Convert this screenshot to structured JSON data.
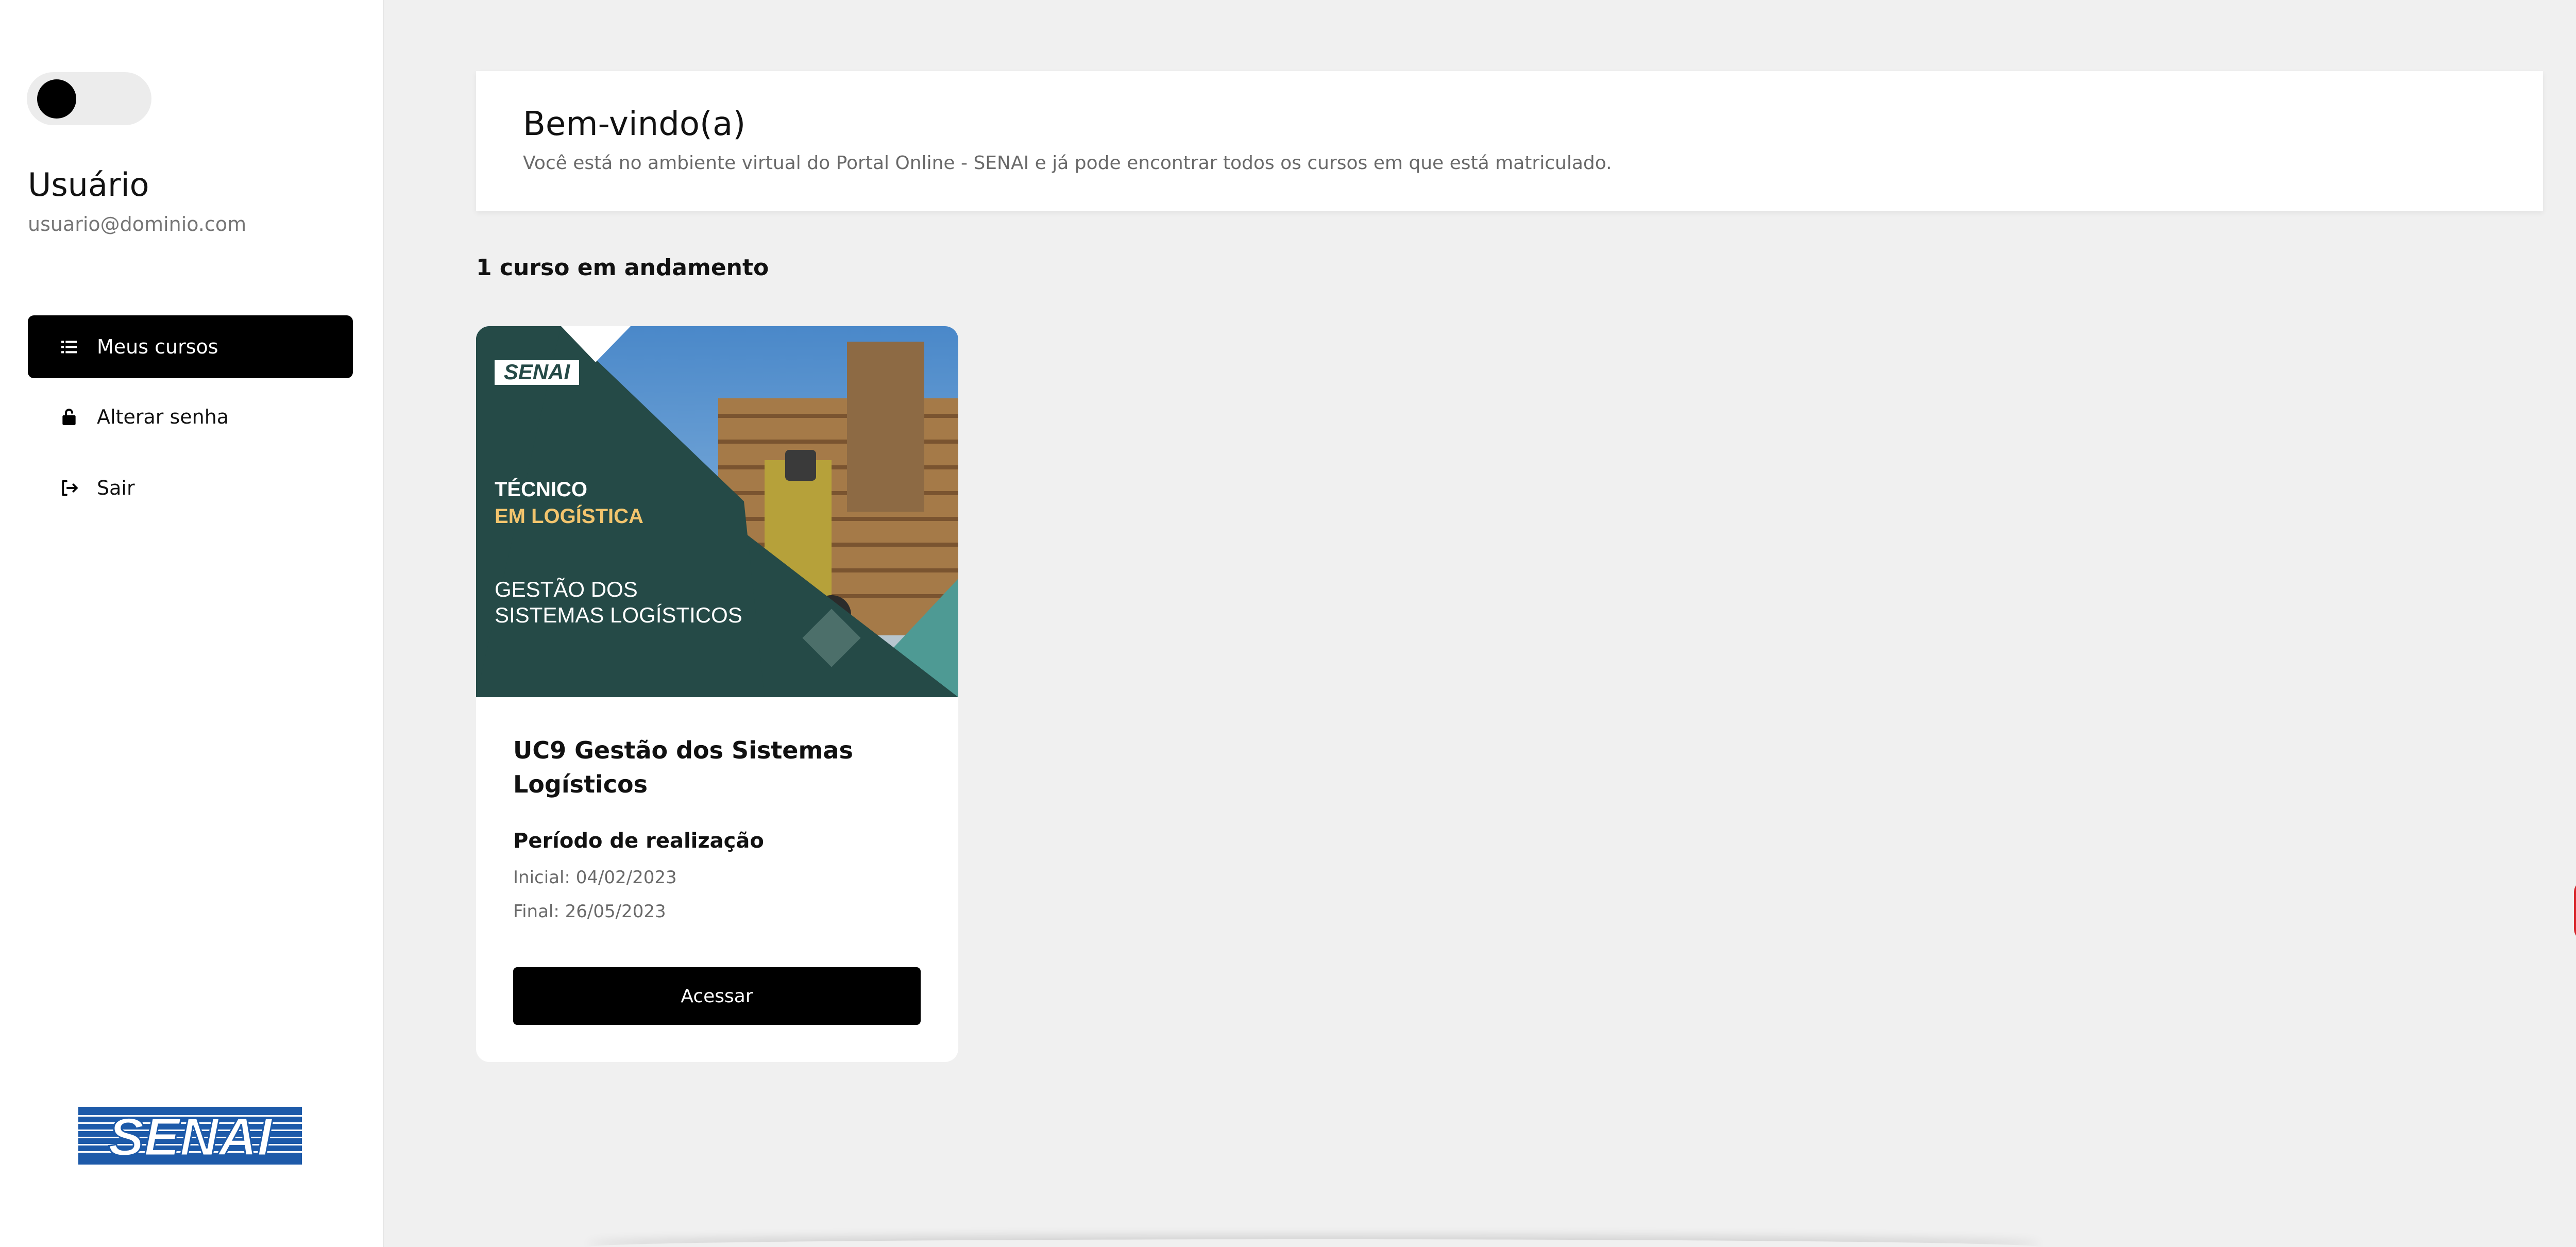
{
  "sidebar": {
    "user_name": "Usuário",
    "user_email": "usuario@dominio.com",
    "nav": [
      {
        "label": "Meus cursos",
        "icon": "list-icon"
      },
      {
        "label": "Alterar senha",
        "icon": "lock-icon"
      },
      {
        "label": "Sair",
        "icon": "logout-icon"
      }
    ],
    "logo_text": "SENAI"
  },
  "welcome": {
    "title": "Bem-vindo(a)",
    "subtitle": "Você está no ambiente virtual do Portal Online - SENAI e já pode encontrar todos os cursos em que está matriculado."
  },
  "courses": {
    "count_label": "1 curso em andamento",
    "items": [
      {
        "banner": {
          "brand": "SENAI",
          "line1": "TÉCNICO",
          "line2": "EM LOGÍSTICA",
          "line3": "GESTÃO DOS",
          "line4": "SISTEMAS LOGÍSTICOS"
        },
        "title": "UC9 Gestão dos Sistemas Logísticos",
        "period_label": "Período de realização",
        "start": "Inicial: 04/02/2023",
        "end": "Final: 26/05/2023",
        "button_label": "Acessar"
      }
    ]
  },
  "colors": {
    "banner_bg": "#254a47",
    "banner_accent": "#f2c46d",
    "libras_button": "#1f5fb0",
    "accessibility_button": "#d8262b",
    "senai_blue": "#1d5aa9"
  }
}
